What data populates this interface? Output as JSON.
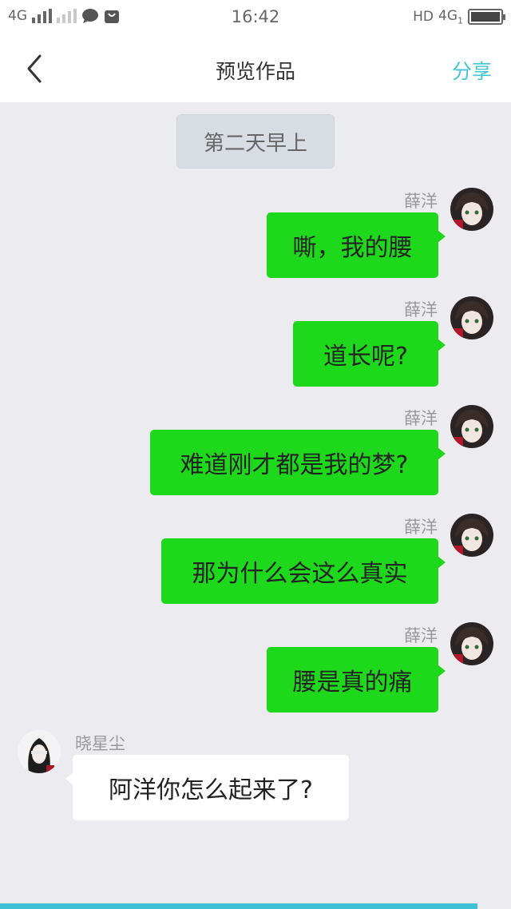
{
  "status_bar": {
    "network_left": "4G",
    "time": "16:42",
    "network_right": "HD",
    "network_right_2": "4G",
    "network_right_sub": "1",
    "battery_level": 1.0
  },
  "nav": {
    "back_icon": "chevron-left-icon",
    "title": "预览作品",
    "share_label": "分享"
  },
  "chat": {
    "time_divider": "第二天早上",
    "messages": [
      {
        "sender": "薛洋",
        "text": "嘶，我的腰",
        "side": "right"
      },
      {
        "sender": "薛洋",
        "text": "道长呢?",
        "side": "right"
      },
      {
        "sender": "薛洋",
        "text": "难道刚才都是我的梦?",
        "side": "right"
      },
      {
        "sender": "薛洋",
        "text": "那为什么会这么真实",
        "side": "right"
      },
      {
        "sender": "薛洋",
        "text": "腰是真的痛",
        "side": "right"
      },
      {
        "sender": "晓星尘",
        "text": "阿洋你怎么起来了?",
        "side": "left"
      }
    ]
  },
  "colors": {
    "bubble_me": "#1ed81c",
    "bubble_other": "#ffffff",
    "accent": "#45c4d6",
    "background": "#ececf0"
  }
}
